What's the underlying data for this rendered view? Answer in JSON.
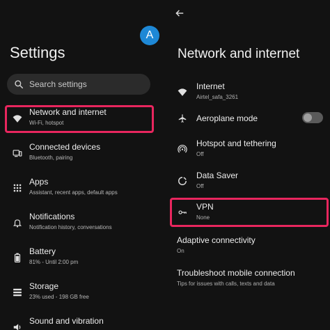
{
  "colors": {
    "background": "#121212",
    "accent": "#1e88d6",
    "highlight": "#e8265e"
  },
  "settings": {
    "avatar_letter": "A",
    "title": "Settings",
    "search": {
      "placeholder": "Search settings"
    },
    "items": [
      {
        "icon": "wifi-icon",
        "title": "Network and internet",
        "subtitle": "Wi-Fi, hotspot"
      },
      {
        "icon": "devices-icon",
        "title": "Connected devices",
        "subtitle": "Bluetooth, pairing"
      },
      {
        "icon": "apps-grid-icon",
        "title": "Apps",
        "subtitle": "Assistant, recent apps, default apps"
      },
      {
        "icon": "bell-icon",
        "title": "Notifications",
        "subtitle": "Notification history, conversations"
      },
      {
        "icon": "battery-icon",
        "title": "Battery",
        "subtitle": "81% - Until 2:00 pm"
      },
      {
        "icon": "storage-icon",
        "title": "Storage",
        "subtitle": "23% used - 198 GB free"
      },
      {
        "icon": "volume-icon",
        "title": "Sound and vibration",
        "subtitle": ""
      }
    ]
  },
  "network": {
    "title": "Network and internet",
    "items": [
      {
        "icon": "wifi-icon",
        "title": "Internet",
        "subtitle": "Airtel_safa_3261"
      },
      {
        "icon": "airplane-icon",
        "title": "Aeroplane mode",
        "subtitle": "",
        "toggle_on": false
      },
      {
        "icon": "hotspot-icon",
        "title": "Hotspot and tethering",
        "subtitle": "Off"
      },
      {
        "icon": "data-saver-icon",
        "title": "Data Saver",
        "subtitle": "Off"
      },
      {
        "icon": "vpn-key-icon",
        "title": "VPN",
        "subtitle": "None"
      },
      {
        "icon": "",
        "title": "Adaptive connectivity",
        "subtitle": "On"
      },
      {
        "icon": "",
        "title": "Troubleshoot mobile connection",
        "subtitle": "Tips for issues with calls, texts and data"
      }
    ]
  }
}
